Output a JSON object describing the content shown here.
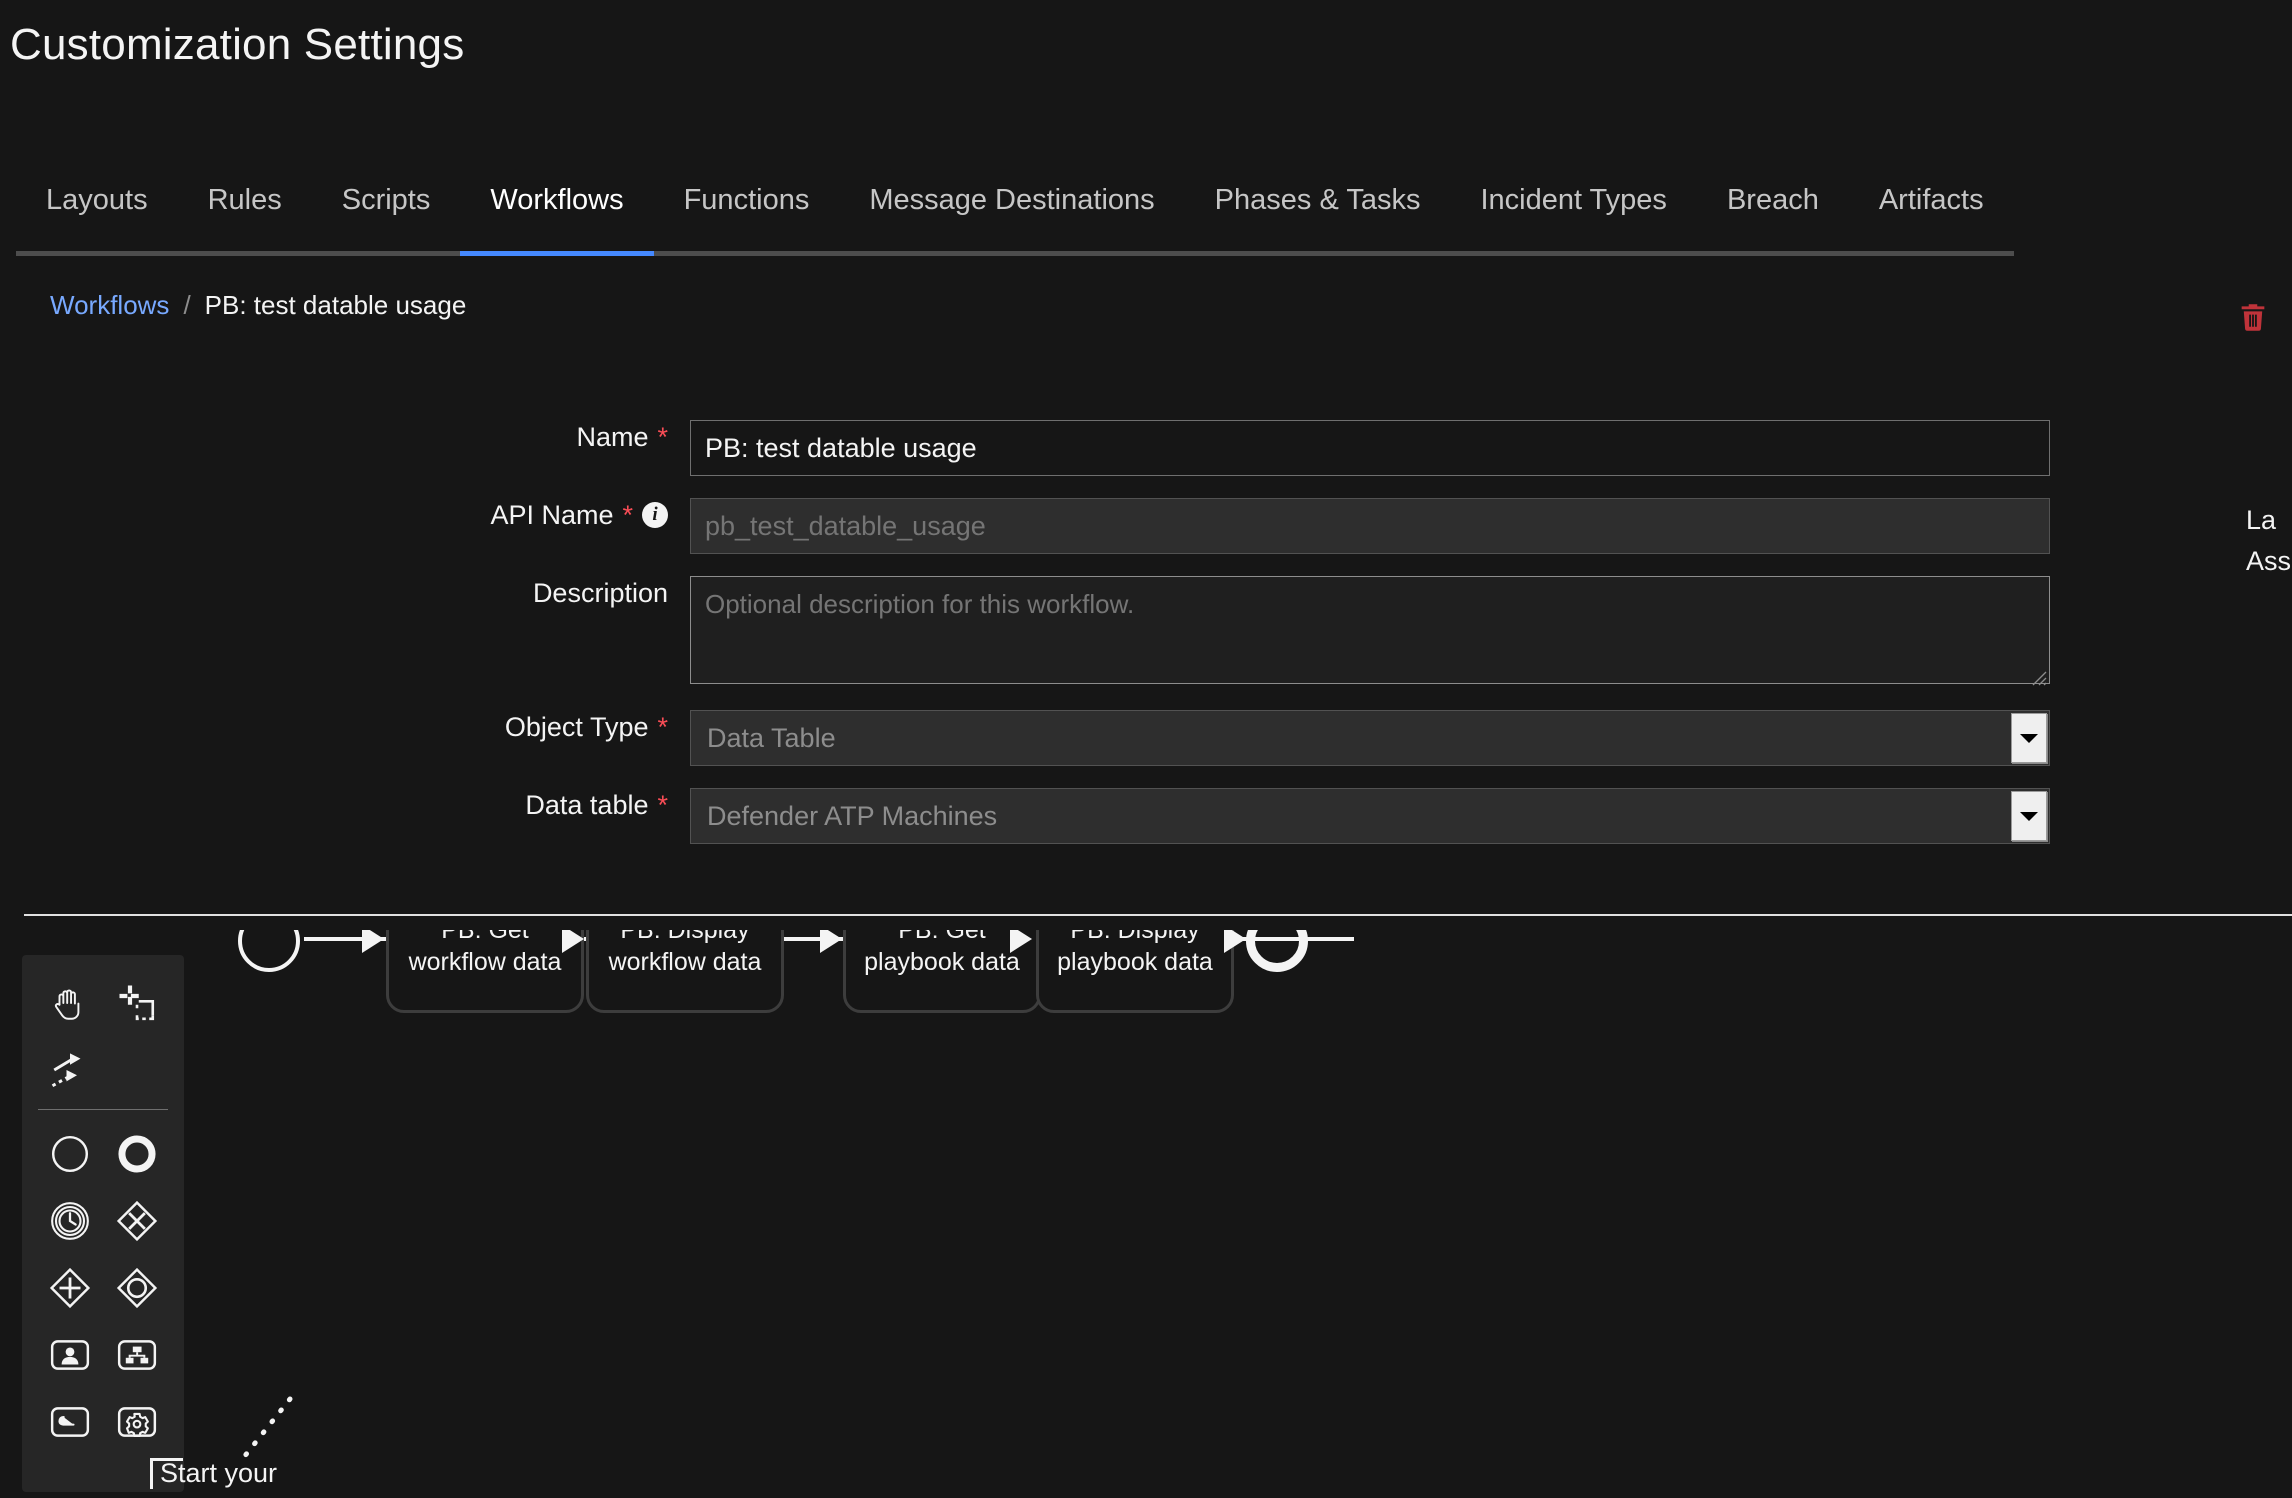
{
  "header": {
    "title": "Customization Settings"
  },
  "tabs": [
    {
      "label": "Layouts",
      "active": false
    },
    {
      "label": "Rules",
      "active": false
    },
    {
      "label": "Scripts",
      "active": false
    },
    {
      "label": "Workflows",
      "active": true
    },
    {
      "label": "Functions",
      "active": false
    },
    {
      "label": "Message Destinations",
      "active": false
    },
    {
      "label": "Phases & Tasks",
      "active": false
    },
    {
      "label": "Incident Types",
      "active": false
    },
    {
      "label": "Breach",
      "active": false
    },
    {
      "label": "Artifacts",
      "active": false
    }
  ],
  "breadcrumb": {
    "parent": "Workflows",
    "separator": "/",
    "current": "PB: test datable usage"
  },
  "actions": {
    "delete_icon": "trash-icon",
    "delete_color": "#c0333a"
  },
  "form": {
    "name": {
      "label": "Name",
      "required_marker": "*",
      "value": "PB: test datable usage",
      "placeholder": "Name"
    },
    "api_name": {
      "label": "API Name",
      "required_marker": "*",
      "info_icon": "info-icon",
      "value": "",
      "placeholder": "pb_test_datable_usage"
    },
    "description": {
      "label": "Description",
      "value": "",
      "placeholder": "Optional description for this workflow."
    },
    "object_type": {
      "label": "Object Type",
      "required_marker": "*",
      "value": "Data Table",
      "options": [
        "Data Table"
      ]
    },
    "data_table": {
      "label": "Data table",
      "required_marker": "*",
      "value": "Defender ATP Machines",
      "options": [
        "Defender ATP Machines"
      ]
    }
  },
  "side_meta": {
    "line1": "La",
    "line2": "Ass"
  },
  "palette": {
    "tools": [
      {
        "name": "hand-pan-icon"
      },
      {
        "name": "marquee-select-icon"
      },
      {
        "name": "connector-arrows-icon"
      }
    ],
    "shapes": [
      {
        "name": "start-event-icon"
      },
      {
        "name": "end-event-icon"
      },
      {
        "name": "timer-event-icon"
      },
      {
        "name": "exclusive-gateway-icon"
      },
      {
        "name": "parallel-gateway-icon"
      },
      {
        "name": "inclusive-gateway-icon"
      },
      {
        "name": "user-task-icon"
      },
      {
        "name": "subprocess-task-icon"
      },
      {
        "name": "script-task-icon"
      },
      {
        "name": "service-task-icon"
      }
    ]
  },
  "diagram": {
    "start_event": "start-event",
    "end_event": "end-event",
    "nodes": [
      {
        "line1": "PB: Get",
        "line2": "workflow data",
        "badge": "function-fx-icon"
      },
      {
        "line1": "PB: Display",
        "line2": "workflow data",
        "badge": "script-icon"
      },
      {
        "line1": "PB: Get",
        "line2": "playbook data",
        "badge": "function-fx-icon"
      },
      {
        "line1": "PB: Display",
        "line2": "playbook data",
        "badge": "script-icon"
      }
    ],
    "badge_color": "#f1c21b",
    "callout": "Start your"
  }
}
